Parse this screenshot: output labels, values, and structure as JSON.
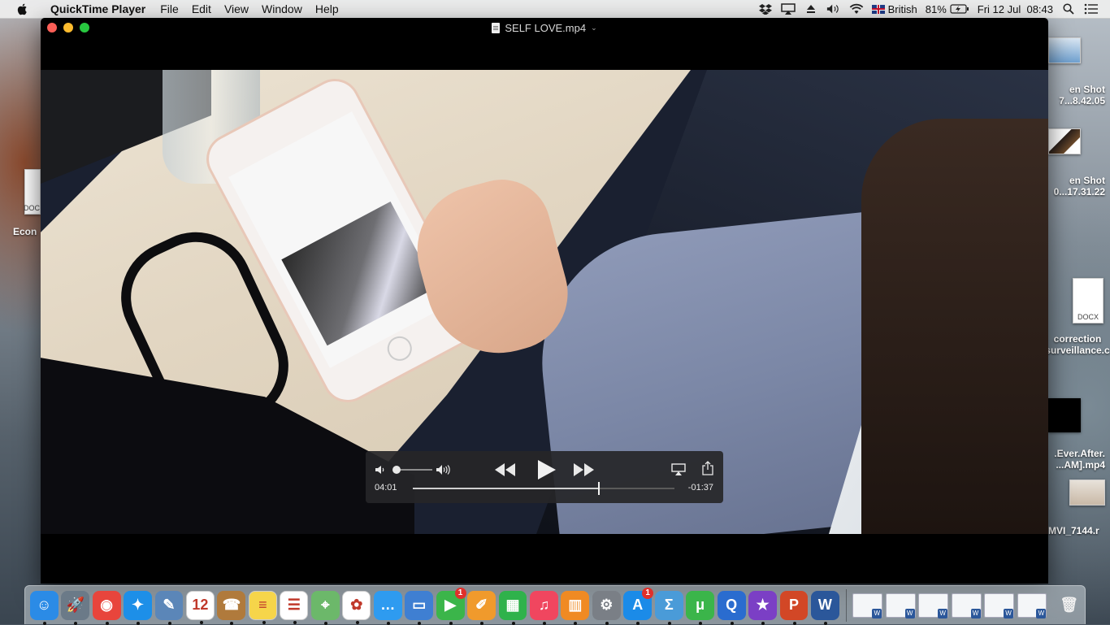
{
  "menubar": {
    "app_name": "QuickTime Player",
    "items": [
      "File",
      "Edit",
      "View",
      "Window",
      "Help"
    ],
    "status": {
      "input_source": "British",
      "battery": "81%",
      "clock": "Fri 12 Jul  08:43"
    }
  },
  "window": {
    "title": "SELF LOVE.mp4"
  },
  "player": {
    "elapsed": "04:01",
    "remaining": "-01:37",
    "progress_fraction": 0.71,
    "volume_fraction": 0.05
  },
  "desktop": {
    "items": [
      {
        "line1": "en Shot",
        "line2": "7...8.42.05"
      },
      {
        "line1": "en Shot",
        "line2": "0...17.31.22"
      },
      {
        "line1": "correction",
        "line2": "surveillance.c"
      },
      {
        "line1": ".Ever.After.",
        "line2": "...AM].mp4"
      },
      {
        "line1": "MVI_7144.r",
        "line2": ""
      },
      {
        "line1": "Econ",
        "line2": ""
      }
    ],
    "docx_label": "DOCX",
    "doc_label_left": "DOC"
  },
  "dock": {
    "apps": [
      {
        "name": "finder-app",
        "glyph": "☺",
        "color": "#2b8be6"
      },
      {
        "name": "launchpad-app",
        "glyph": "🚀",
        "color": "#6b7a88"
      },
      {
        "name": "chrome-app",
        "glyph": "◉",
        "color": "#e8453c"
      },
      {
        "name": "safari-app",
        "glyph": "✦",
        "color": "#1d8fe8"
      },
      {
        "name": "preview-app",
        "glyph": "✎",
        "color": "#5b86b8"
      },
      {
        "name": "calendar-app",
        "glyph": "12",
        "color": "#ffffff"
      },
      {
        "name": "contacts-app",
        "glyph": "☎",
        "color": "#b07a3c"
      },
      {
        "name": "notes-app",
        "glyph": "≡",
        "color": "#f6d54a"
      },
      {
        "name": "reminders-app",
        "glyph": "☰",
        "color": "#ffffff"
      },
      {
        "name": "maps-app",
        "glyph": "⌖",
        "color": "#6cb86a"
      },
      {
        "name": "photos-app",
        "glyph": "✿",
        "color": "#ffffff"
      },
      {
        "name": "messages-app",
        "glyph": "…",
        "color": "#2e9bf0"
      },
      {
        "name": "keynote-app",
        "glyph": "▭",
        "color": "#3f7fd2"
      },
      {
        "name": "facetime-app",
        "glyph": "▶",
        "color": "#3bb54a",
        "badge": "1"
      },
      {
        "name": "pages-app",
        "glyph": "✐",
        "color": "#f09a2c"
      },
      {
        "name": "numbers-app",
        "glyph": "▦",
        "color": "#2fb24b"
      },
      {
        "name": "itunes-app",
        "glyph": "♫",
        "color": "#f0465f"
      },
      {
        "name": "ibooks-app",
        "glyph": "▥",
        "color": "#f08a23"
      },
      {
        "name": "system-preferences-app",
        "glyph": "⚙",
        "color": "#7a7f86"
      },
      {
        "name": "app-store-app",
        "glyph": "A",
        "color": "#1b8be8",
        "badge": "1"
      },
      {
        "name": "grapher-app",
        "glyph": "Σ",
        "color": "#4a9bd8"
      },
      {
        "name": "utorrent-app",
        "glyph": "μ",
        "color": "#3bb54a"
      },
      {
        "name": "quicktime-app",
        "glyph": "Q",
        "color": "#2a6ccf"
      },
      {
        "name": "imovie-app",
        "glyph": "★",
        "color": "#7b3fc5"
      },
      {
        "name": "powerpoint-app",
        "glyph": "P",
        "color": "#d24726"
      },
      {
        "name": "word-app",
        "glyph": "W",
        "color": "#2b579a"
      }
    ],
    "minimized_count": 6,
    "trash_glyph": "🗑"
  }
}
